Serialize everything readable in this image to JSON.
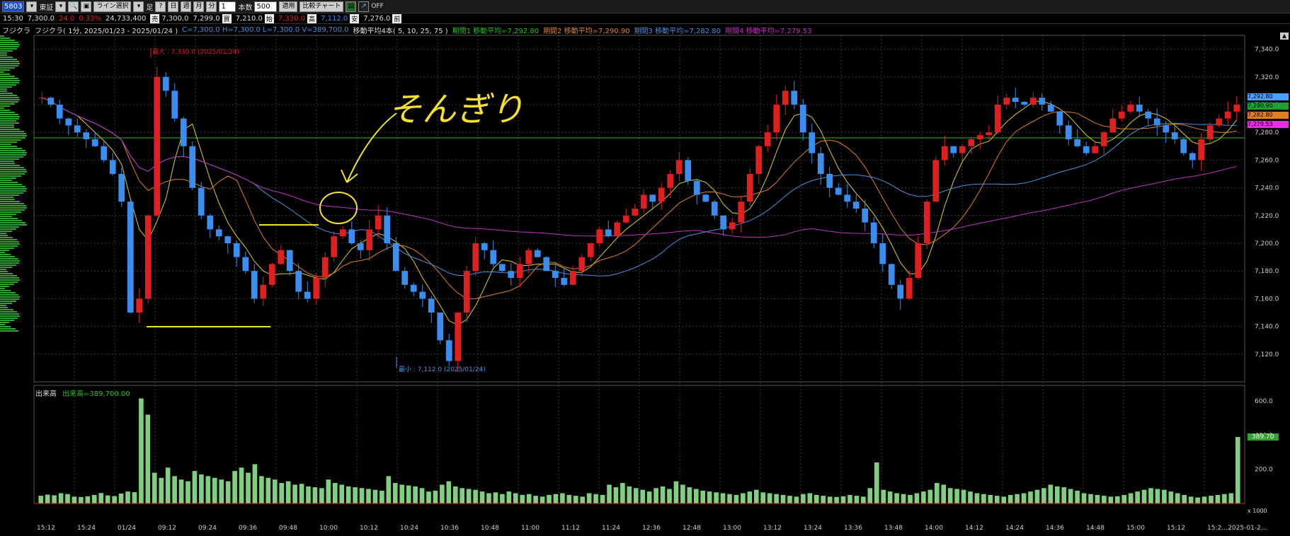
{
  "toolbar": {
    "symbol_code": "5803",
    "market": "東証",
    "search_label": "検索",
    "print_label": "印",
    "line_select": "ライン選択",
    "timeframe_fixed": "足",
    "tf_day": "日",
    "tf_week": "週",
    "tf_month": "月",
    "tf_min_prefix": "分",
    "tf_minutes": "1",
    "count_label": "本数",
    "count_value": "500",
    "apply_label": "適用",
    "compare_chart": "比較チャート",
    "off_label": "OFF"
  },
  "quote": {
    "time": "15:30",
    "price": "7,300.0",
    "change": "24.0",
    "change_pct": "0.33%",
    "volume": "24,733,400",
    "ask_label": "売",
    "ask": "7,300.0",
    "bid": "7,299.0",
    "bid_label": "買",
    "open": "7,210.0",
    "open_label": "始",
    "high": "7,330.0",
    "high_label": "高",
    "low": "7,112.0",
    "low_label": "安",
    "prev": "7,276.0",
    "prev_label": "前"
  },
  "header": {
    "left_name": "フジクラ",
    "chart_title": "フジクラ( 1分, 2025/01/23 - 2025/01/24 )",
    "ohlcv": "C=7,300.0  H=7,300.0  L=7,300.0  V=389,700.0",
    "ma_title": "移動平均4本( 5, 10, 25, 75 )",
    "ma1": "期間1 移動平均=7,292.80",
    "ma2": "期間2 移動平均=7,290.90",
    "ma3": "期間3 移動平均=7,282.80",
    "ma4": "期間4 移動平均=7,279.53"
  },
  "annotations": {
    "max_label": "最大 : 7,330.0 (2025/01/24)",
    "min_label": "最小 : 7,112.0 (2025/01/24)",
    "handwritten": "そんぎり"
  },
  "volume_panel": {
    "title": "出来高",
    "value_label": "出来高=389,700.00",
    "last_badge": "389.70",
    "unit": "x 1000"
  },
  "price_tags": {
    "tag1": "7,292.80",
    "tag2": "7,290.90",
    "tag3": "7,282.80",
    "tag4": "7,279.53"
  },
  "colors": {
    "up": "#e02020",
    "down": "#3a8ef0",
    "ma5": "#e0d020",
    "ma10": "#e08020",
    "ma25": "#4a90e0",
    "ma75": "#c030c0",
    "volume": "#7fd07f",
    "hline": "#20c020",
    "annotation": "#f5e030"
  },
  "chart_data": [
    {
      "type": "candlestick",
      "title": "フジクラ( 1分, 2025/01/23 - 2025/01/24 )",
      "xlabel": "",
      "ylabel": "",
      "ylim": [
        7100,
        7350
      ],
      "y_ticks": [
        7120,
        7140,
        7160,
        7180,
        7200,
        7220,
        7240,
        7260,
        7280,
        7300,
        7320,
        7340
      ],
      "x_ticks": [
        "15:12",
        "15:24",
        "01/24",
        "09:12",
        "09:24",
        "09:36",
        "09:48",
        "10:00",
        "10:12",
        "10:24",
        "10:36",
        "10:48",
        "11:00",
        "11:12",
        "11:24",
        "12:36",
        "12:48",
        "13:00",
        "13:12",
        "13:24",
        "13:36",
        "13:48",
        "14:00",
        "14:12",
        "14:24",
        "14:36",
        "14:48",
        "15:00",
        "15:12",
        "15:2…2025-01-2…"
      ],
      "price_path": [
        7305,
        7300,
        7290,
        7285,
        7280,
        7275,
        7270,
        7260,
        7250,
        7230,
        7150,
        7160,
        7220,
        7320,
        7310,
        7290,
        7270,
        7240,
        7220,
        7210,
        7205,
        7200,
        7190,
        7180,
        7160,
        7170,
        7185,
        7195,
        7180,
        7165,
        7160,
        7175,
        7190,
        7205,
        7210,
        7200,
        7195,
        7210,
        7220,
        7200,
        7180,
        7170,
        7165,
        7160,
        7150,
        7130,
        7115,
        7150,
        7180,
        7200,
        7195,
        7185,
        7180,
        7175,
        7185,
        7195,
        7190,
        7180,
        7175,
        7170,
        7180,
        7190,
        7200,
        7210,
        7205,
        7215,
        7220,
        7225,
        7235,
        7230,
        7240,
        7250,
        7260,
        7245,
        7235,
        7230,
        7220,
        7210,
        7215,
        7230,
        7250,
        7270,
        7280,
        7300,
        7310,
        7300,
        7280,
        7265,
        7250,
        7240,
        7235,
        7230,
        7225,
        7215,
        7200,
        7185,
        7170,
        7160,
        7175,
        7200,
        7230,
        7260,
        7270,
        7265,
        7270,
        7275,
        7278,
        7280,
        7300,
        7305,
        7302,
        7300,
        7305,
        7300,
        7295,
        7285,
        7275,
        7270,
        7265,
        7270,
        7280,
        7290,
        7295,
        7300,
        7295,
        7290,
        7285,
        7280,
        7275,
        7265,
        7260,
        7275,
        7285,
        7290,
        7295,
        7300
      ],
      "max": {
        "value": 7330.0,
        "date": "2025/01/24"
      },
      "min": {
        "value": 7112.0,
        "date": "2025/01/24"
      },
      "horizontal_line": 7276.0
    },
    {
      "type": "bar",
      "title": "出来高",
      "ylabel": "",
      "ylim": [
        0,
        650
      ],
      "y_ticks": [
        200,
        400,
        600
      ],
      "volume_scale": "x 1000",
      "values": [
        45,
        52,
        48,
        60,
        55,
        40,
        38,
        42,
        50,
        61,
        47,
        43,
        58,
        70,
        66,
        615,
        520,
        180,
        150,
        210,
        160,
        140,
        130,
        190,
        170,
        160,
        150,
        140,
        130,
        190,
        210,
        180,
        230,
        160,
        150,
        140,
        120,
        130,
        110,
        115,
        100,
        95,
        90,
        140,
        120,
        110,
        100,
        95,
        90,
        85,
        80,
        75,
        160,
        120,
        110,
        105,
        100,
        90,
        70,
        75,
        110,
        130,
        100,
        90,
        85,
        80,
        70,
        60,
        65,
        55,
        70,
        60,
        50,
        55,
        45,
        40,
        50,
        55,
        60,
        50,
        45,
        40,
        60,
        55,
        50,
        110,
        95,
        120,
        100,
        90,
        80,
        70,
        90,
        100,
        85,
        130,
        110,
        95,
        85,
        75,
        70,
        65,
        60,
        55,
        50,
        60,
        70,
        80,
        65,
        60,
        55,
        50,
        45,
        40,
        55,
        60,
        50,
        45,
        40,
        38,
        42,
        50,
        45,
        40,
        90,
        240,
        80,
        70,
        60,
        55,
        50,
        60,
        70,
        80,
        120,
        110,
        90,
        85,
        80,
        70,
        60,
        55,
        50,
        45,
        40,
        50,
        55,
        60,
        70,
        80,
        90,
        110,
        100,
        95,
        85,
        75,
        60,
        55,
        50,
        45,
        40,
        42,
        50,
        60,
        70,
        80,
        90,
        85,
        80,
        70,
        60,
        50,
        40,
        35,
        40,
        45,
        50,
        55,
        60,
        389
      ]
    }
  ]
}
